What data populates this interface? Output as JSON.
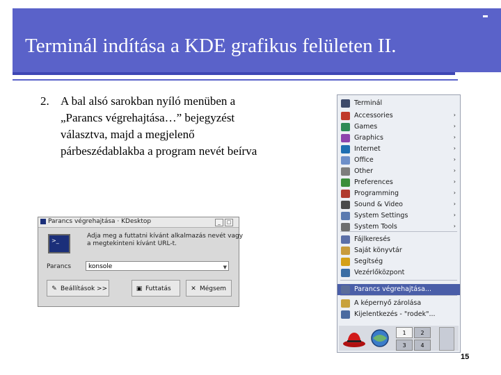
{
  "slide": {
    "title": "Terminál indítása a KDE grafikus felületen II.",
    "body_number": "2.",
    "body_lines": [
      "A bal alsó sarokban nyíló menüben a",
      "„Parancs végrehajtása…” bejegyzést",
      "választva, majd a megjelenő",
      "párbeszédablakba a program nevét beírva"
    ],
    "page_number": "15"
  },
  "dialog": {
    "title": "Parancs végrehajtása · KDesktop",
    "message_lines": [
      "Adja meg a futtatni kívánt alkalmazás nevét vagy",
      "a megtekinteni kívánt URL-t."
    ],
    "command_label": "Parancs",
    "command_value": "konsole",
    "options_button": "Beállítások >>",
    "run_button": "Futtatás",
    "cancel_button": "Mégsem",
    "titlebar_buttons": [
      "_",
      "□",
      "×"
    ]
  },
  "menu": {
    "items": [
      {
        "label": "Terminál",
        "icon": "terminal-icon",
        "color": "#3d4a6a",
        "submenu": false
      },
      {
        "label": "Accessories",
        "icon": "accessories-icon",
        "color": "#c0392b",
        "submenu": true
      },
      {
        "label": "Games",
        "icon": "games-icon",
        "color": "#2e8b57",
        "submenu": true
      },
      {
        "label": "Graphics",
        "icon": "graphics-icon",
        "color": "#8e44ad",
        "submenu": true
      },
      {
        "label": "Internet",
        "icon": "internet-icon",
        "color": "#1f6fb2",
        "submenu": true
      },
      {
        "label": "Office",
        "icon": "office-icon",
        "color": "#6d8fc9",
        "submenu": true
      },
      {
        "label": "Other",
        "icon": "other-icon",
        "color": "#7d7d7d",
        "submenu": true
      },
      {
        "label": "Preferences",
        "icon": "preferences-icon",
        "color": "#3b8e3b",
        "submenu": true
      },
      {
        "label": "Programming",
        "icon": "programming-icon",
        "color": "#b03a2e",
        "submenu": true
      },
      {
        "label": "Sound & Video",
        "icon": "sound-video-icon",
        "color": "#4a4a4a",
        "submenu": true
      },
      {
        "label": "System Settings",
        "icon": "system-settings-icon",
        "color": "#5a7ab0",
        "submenu": true
      },
      {
        "label": "System Tools",
        "icon": "system-tools-icon",
        "color": "#6e6e6e",
        "submenu": true
      },
      {
        "label": "Fájlkeresés",
        "icon": "file-search-icon",
        "color": "#5b6fa8",
        "submenu": false
      },
      {
        "label": "Saját könyvtár",
        "icon": "home-folder-icon",
        "color": "#c89b3c",
        "submenu": false
      },
      {
        "label": "Segítség",
        "icon": "help-icon",
        "color": "#d4a017",
        "submenu": false
      },
      {
        "label": "Vezérlőközpont",
        "icon": "control-center-icon",
        "color": "#3a6ea5",
        "submenu": false
      },
      {
        "label": "Parancs végrehajtása...",
        "icon": "run-command-icon",
        "color": "#5a6c99",
        "submenu": false
      },
      {
        "label": "A képernyő zárolása",
        "icon": "lock-icon",
        "color": "#c8a23c",
        "submenu": false
      },
      {
        "label": "Kijelentkezés - \"rodek\"...",
        "icon": "logout-icon",
        "color": "#4a6aa0",
        "submenu": false
      }
    ],
    "selected": "Parancs végrehajtása...",
    "pager": [
      "1",
      "2",
      "3",
      "4"
    ]
  },
  "colors": {
    "header": "#5a62c9",
    "header_line": "#3e46b4",
    "menu_selection": "#4a5ea8"
  }
}
